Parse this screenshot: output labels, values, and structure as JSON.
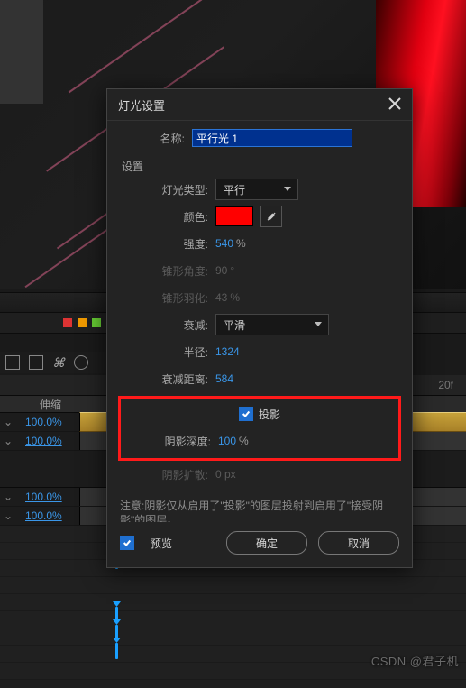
{
  "dialog": {
    "title": "灯光设置",
    "name_label": "名称:",
    "name_value": "平行光 1",
    "settings_label": "设置",
    "light_type_label": "灯光类型:",
    "light_type_value": "平行",
    "color_label": "颜色:",
    "color_value": "#ff0000",
    "intensity_label": "强度:",
    "intensity_value": "540",
    "intensity_unit": "%",
    "cone_angle_label": "锥形角度:",
    "cone_angle_value": "90",
    "cone_angle_unit": "°",
    "cone_feather_label": "锥形羽化:",
    "cone_feather_value": "43",
    "cone_feather_unit": "%",
    "falloff_label": "衰减:",
    "falloff_value": "平滑",
    "radius_label": "半径:",
    "radius_value": "1324",
    "falloff_dist_label": "衰减距离:",
    "falloff_dist_value": "584",
    "cast_shadow_label": "投影",
    "shadow_depth_label": "阴影深度:",
    "shadow_depth_value": "100",
    "shadow_depth_unit": "%",
    "shadow_diffusion_label": "阴影扩散:",
    "shadow_diffusion_value": "0 px",
    "note": "注意:阴影仅从启用了\"投影\"的图层投射到启用了\"接受阴影\"的图层。",
    "preview_label": "预览",
    "ok": "确定",
    "cancel": "取消"
  },
  "timeline": {
    "time_label": "20f",
    "col_header": "伸缩",
    "rows": [
      {
        "pct": "100.0%",
        "gold": true
      },
      {
        "pct": "100.0%",
        "gold": false
      },
      {
        "pct": "100.0%",
        "gold": false
      },
      {
        "pct": "100.0%",
        "gold": false
      }
    ]
  },
  "watermark": "CSDN @君子机"
}
